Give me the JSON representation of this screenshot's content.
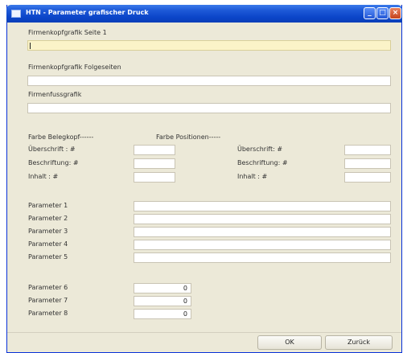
{
  "window": {
    "title": "HTN - Parameter grafischer Druck"
  },
  "header_fields": [
    {
      "label": "Firmenkopfgrafik Seite 1",
      "value": ""
    },
    {
      "label": "Firmenkopfgrafik Folgeseiten",
      "value": ""
    },
    {
      "label": "Firmenfussgrafik",
      "value": ""
    }
  ],
  "colors": {
    "belegkopf_heading": "Farbe Belegkopf------",
    "positionen_heading": "Farbe Positionen-----",
    "belegkopf": [
      {
        "label": "Überschrift : #",
        "value": ""
      },
      {
        "label": "Beschriftung: #",
        "value": ""
      },
      {
        "label": "Inhalt      : #",
        "value": ""
      }
    ],
    "positionen": [
      {
        "label": "Überschrift:  #",
        "value": ""
      },
      {
        "label": "Beschriftung: #",
        "value": ""
      },
      {
        "label": "Inhalt      : #",
        "value": ""
      }
    ]
  },
  "parameters_text": [
    {
      "label": "Parameter 1",
      "value": ""
    },
    {
      "label": "Parameter 2",
      "value": ""
    },
    {
      "label": "Parameter 3",
      "value": ""
    },
    {
      "label": "Parameter 4",
      "value": ""
    },
    {
      "label": "Parameter 5",
      "value": ""
    }
  ],
  "parameters_num": [
    {
      "label": "Parameter 6",
      "value": "0"
    },
    {
      "label": "Parameter 7",
      "value": "0"
    },
    {
      "label": "Parameter 8",
      "value": "0"
    }
  ],
  "buttons": {
    "ok": "OK",
    "back": "Zurück"
  }
}
